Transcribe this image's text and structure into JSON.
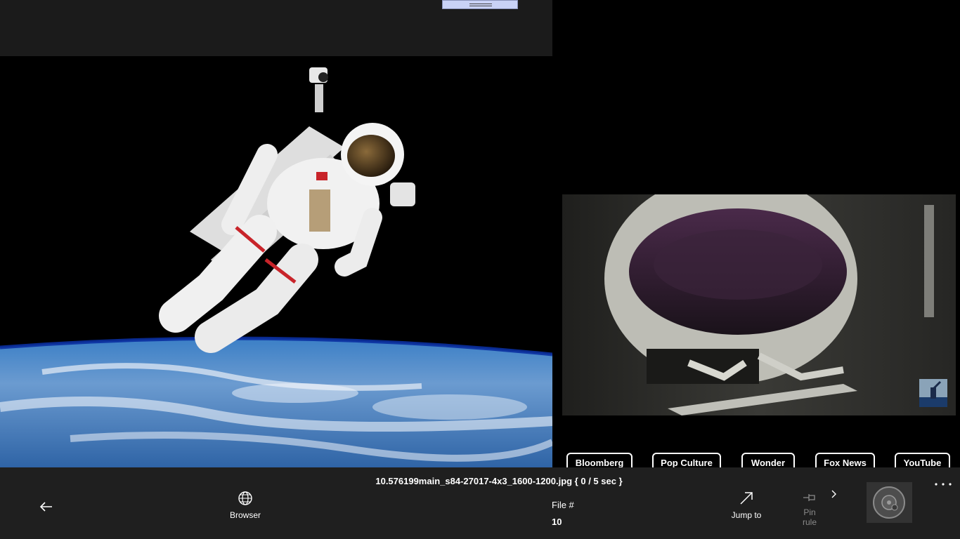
{
  "viewer": {
    "filename": "10.576199main_s84-27017-4x3_1600-1200.jpg { 0 / 5 sec }"
  },
  "toolbar": {
    "back_icon": "back-arrow-icon",
    "browser_label": "Browser",
    "browser_icon": "globe-icon",
    "file_label": "File #",
    "file_value": "10",
    "jump_label": "Jump to",
    "jump_icon": "diagonal-arrow-icon",
    "pin_label_line1": "Pin",
    "pin_label_line2": "rule",
    "pin_icon": "pin-icon",
    "more_icon": "more-dots-icon",
    "next_icon": "chevron-right-icon"
  },
  "bookmarks": [
    {
      "label": "Bloomberg"
    },
    {
      "label": "Pop Culture"
    },
    {
      "label": "Wonder"
    },
    {
      "label": "Fox News"
    },
    {
      "label": "YouTube"
    }
  ],
  "colors": {
    "bar_bg": "#1f1f1f",
    "panel_bg": "#1b1b1b",
    "handle": "#c9d2f6"
  }
}
